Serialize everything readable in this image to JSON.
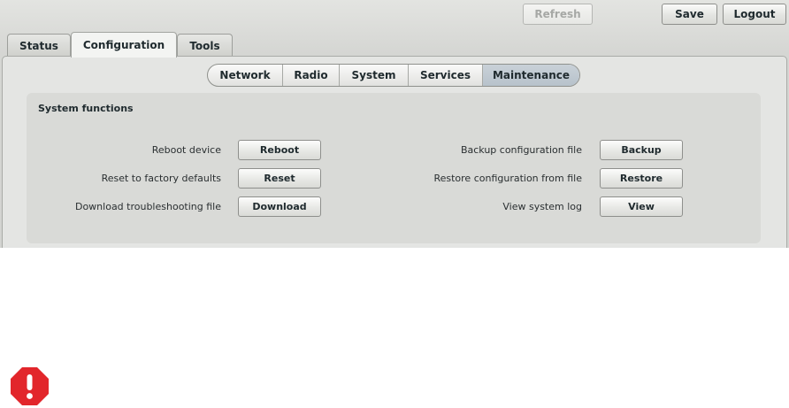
{
  "header": {
    "refresh_label": "Refresh",
    "save_label": "Save",
    "logout_label": "Logout"
  },
  "tabs": [
    {
      "label": "Status"
    },
    {
      "label": "Configuration",
      "active": true
    },
    {
      "label": "Tools"
    }
  ],
  "subtabs": [
    {
      "label": "Network"
    },
    {
      "label": "Radio"
    },
    {
      "label": "System"
    },
    {
      "label": "Services"
    },
    {
      "label": "Maintenance",
      "active": true
    }
  ],
  "system_functions": {
    "title": "System functions",
    "left": [
      {
        "label": "Reboot device",
        "button": "Reboot"
      },
      {
        "label": "Reset to factory defaults",
        "button": "Reset"
      },
      {
        "label": "Download troubleshooting file",
        "button": "Download"
      }
    ],
    "right": [
      {
        "label": "Backup configuration file",
        "button": "Backup"
      },
      {
        "label": "Restore configuration from file",
        "button": "Restore"
      },
      {
        "label": "View system log",
        "button": "View"
      }
    ]
  },
  "icons": {
    "warning": "exclamation-warning-icon"
  },
  "colors": {
    "warning": "#e2262b",
    "active_subtab": "#bcc6ce"
  }
}
